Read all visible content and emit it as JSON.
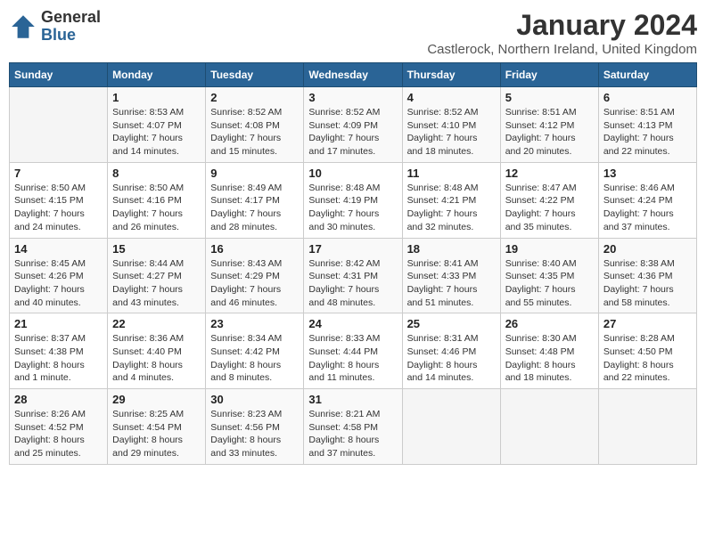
{
  "logo": {
    "general": "General",
    "blue": "Blue"
  },
  "title": "January 2024",
  "location": "Castlerock, Northern Ireland, United Kingdom",
  "days_of_week": [
    "Sunday",
    "Monday",
    "Tuesday",
    "Wednesday",
    "Thursday",
    "Friday",
    "Saturday"
  ],
  "weeks": [
    [
      {
        "num": "",
        "detail": ""
      },
      {
        "num": "1",
        "detail": "Sunrise: 8:53 AM\nSunset: 4:07 PM\nDaylight: 7 hours\nand 14 minutes."
      },
      {
        "num": "2",
        "detail": "Sunrise: 8:52 AM\nSunset: 4:08 PM\nDaylight: 7 hours\nand 15 minutes."
      },
      {
        "num": "3",
        "detail": "Sunrise: 8:52 AM\nSunset: 4:09 PM\nDaylight: 7 hours\nand 17 minutes."
      },
      {
        "num": "4",
        "detail": "Sunrise: 8:52 AM\nSunset: 4:10 PM\nDaylight: 7 hours\nand 18 minutes."
      },
      {
        "num": "5",
        "detail": "Sunrise: 8:51 AM\nSunset: 4:12 PM\nDaylight: 7 hours\nand 20 minutes."
      },
      {
        "num": "6",
        "detail": "Sunrise: 8:51 AM\nSunset: 4:13 PM\nDaylight: 7 hours\nand 22 minutes."
      }
    ],
    [
      {
        "num": "7",
        "detail": "Sunrise: 8:50 AM\nSunset: 4:15 PM\nDaylight: 7 hours\nand 24 minutes."
      },
      {
        "num": "8",
        "detail": "Sunrise: 8:50 AM\nSunset: 4:16 PM\nDaylight: 7 hours\nand 26 minutes."
      },
      {
        "num": "9",
        "detail": "Sunrise: 8:49 AM\nSunset: 4:17 PM\nDaylight: 7 hours\nand 28 minutes."
      },
      {
        "num": "10",
        "detail": "Sunrise: 8:48 AM\nSunset: 4:19 PM\nDaylight: 7 hours\nand 30 minutes."
      },
      {
        "num": "11",
        "detail": "Sunrise: 8:48 AM\nSunset: 4:21 PM\nDaylight: 7 hours\nand 32 minutes."
      },
      {
        "num": "12",
        "detail": "Sunrise: 8:47 AM\nSunset: 4:22 PM\nDaylight: 7 hours\nand 35 minutes."
      },
      {
        "num": "13",
        "detail": "Sunrise: 8:46 AM\nSunset: 4:24 PM\nDaylight: 7 hours\nand 37 minutes."
      }
    ],
    [
      {
        "num": "14",
        "detail": "Sunrise: 8:45 AM\nSunset: 4:26 PM\nDaylight: 7 hours\nand 40 minutes."
      },
      {
        "num": "15",
        "detail": "Sunrise: 8:44 AM\nSunset: 4:27 PM\nDaylight: 7 hours\nand 43 minutes."
      },
      {
        "num": "16",
        "detail": "Sunrise: 8:43 AM\nSunset: 4:29 PM\nDaylight: 7 hours\nand 46 minutes."
      },
      {
        "num": "17",
        "detail": "Sunrise: 8:42 AM\nSunset: 4:31 PM\nDaylight: 7 hours\nand 48 minutes."
      },
      {
        "num": "18",
        "detail": "Sunrise: 8:41 AM\nSunset: 4:33 PM\nDaylight: 7 hours\nand 51 minutes."
      },
      {
        "num": "19",
        "detail": "Sunrise: 8:40 AM\nSunset: 4:35 PM\nDaylight: 7 hours\nand 55 minutes."
      },
      {
        "num": "20",
        "detail": "Sunrise: 8:38 AM\nSunset: 4:36 PM\nDaylight: 7 hours\nand 58 minutes."
      }
    ],
    [
      {
        "num": "21",
        "detail": "Sunrise: 8:37 AM\nSunset: 4:38 PM\nDaylight: 8 hours\nand 1 minute."
      },
      {
        "num": "22",
        "detail": "Sunrise: 8:36 AM\nSunset: 4:40 PM\nDaylight: 8 hours\nand 4 minutes."
      },
      {
        "num": "23",
        "detail": "Sunrise: 8:34 AM\nSunset: 4:42 PM\nDaylight: 8 hours\nand 8 minutes."
      },
      {
        "num": "24",
        "detail": "Sunrise: 8:33 AM\nSunset: 4:44 PM\nDaylight: 8 hours\nand 11 minutes."
      },
      {
        "num": "25",
        "detail": "Sunrise: 8:31 AM\nSunset: 4:46 PM\nDaylight: 8 hours\nand 14 minutes."
      },
      {
        "num": "26",
        "detail": "Sunrise: 8:30 AM\nSunset: 4:48 PM\nDaylight: 8 hours\nand 18 minutes."
      },
      {
        "num": "27",
        "detail": "Sunrise: 8:28 AM\nSunset: 4:50 PM\nDaylight: 8 hours\nand 22 minutes."
      }
    ],
    [
      {
        "num": "28",
        "detail": "Sunrise: 8:26 AM\nSunset: 4:52 PM\nDaylight: 8 hours\nand 25 minutes."
      },
      {
        "num": "29",
        "detail": "Sunrise: 8:25 AM\nSunset: 4:54 PM\nDaylight: 8 hours\nand 29 minutes."
      },
      {
        "num": "30",
        "detail": "Sunrise: 8:23 AM\nSunset: 4:56 PM\nDaylight: 8 hours\nand 33 minutes."
      },
      {
        "num": "31",
        "detail": "Sunrise: 8:21 AM\nSunset: 4:58 PM\nDaylight: 8 hours\nand 37 minutes."
      },
      {
        "num": "",
        "detail": ""
      },
      {
        "num": "",
        "detail": ""
      },
      {
        "num": "",
        "detail": ""
      }
    ]
  ]
}
